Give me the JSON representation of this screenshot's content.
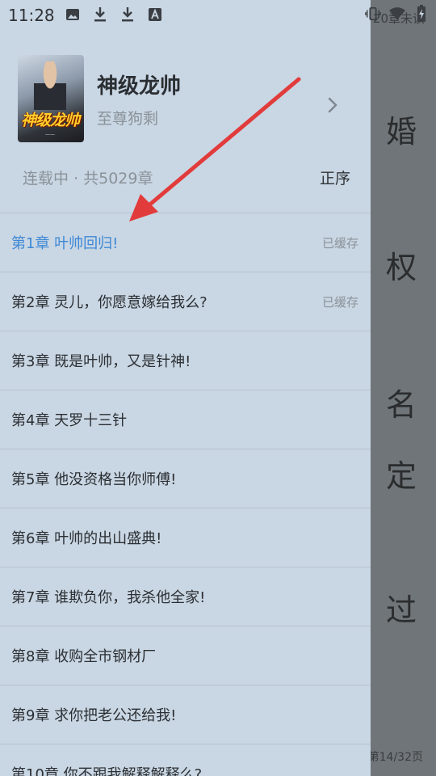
{
  "statusbar": {
    "time": "11:28",
    "left_icons": [
      "image-icon",
      "download-icon",
      "download-icon",
      "text-a-icon"
    ],
    "right_icons": [
      "vibrate-icon",
      "wifi-icon",
      "battery-icon"
    ]
  },
  "reader": {
    "top_text": "20章未读",
    "lines": [
      "婚",
      "权",
      "名",
      "定",
      "过"
    ],
    "page_indicator": "第14/32页"
  },
  "book": {
    "cover_title": "神级龙帅",
    "title": "神级龙帅",
    "author": "至尊狗剩"
  },
  "meta": {
    "status": "连载中 · 共5029章",
    "sort_label": "正序"
  },
  "chapters": [
    {
      "title": "第1章 叶帅回归!",
      "cache": "已缓存",
      "current": true
    },
    {
      "title": "第2章 灵儿，你愿意嫁给我么?",
      "cache": "已缓存",
      "current": false
    },
    {
      "title": "第3章 既是叶帅，又是针神!",
      "cache": "",
      "current": false
    },
    {
      "title": "第4章 天罗十三针",
      "cache": "",
      "current": false
    },
    {
      "title": "第5章 他没资格当你师傅!",
      "cache": "",
      "current": false
    },
    {
      "title": "第6章 叶帅的出山盛典!",
      "cache": "",
      "current": false
    },
    {
      "title": "第7章 谁欺负你，我杀他全家!",
      "cache": "",
      "current": false
    },
    {
      "title": "第8章 收购全市钢材厂",
      "cache": "",
      "current": false
    },
    {
      "title": "第9章 求你把老公还给我!",
      "cache": "",
      "current": false
    },
    {
      "title": "第10章 你不跟我解释解释么?",
      "cache": "",
      "current": false
    }
  ],
  "colors": {
    "drawer_bg": "#c9d6e3",
    "current_chapter": "#3d88d6",
    "annotation_arrow": "#e23b3b"
  }
}
